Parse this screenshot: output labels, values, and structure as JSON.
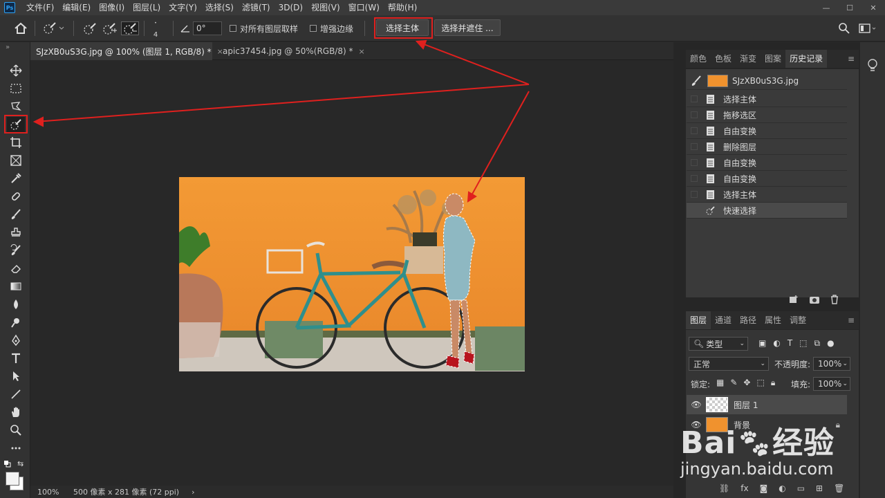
{
  "menubar": {
    "logo": "Ps",
    "items": [
      "文件(F)",
      "编辑(E)",
      "图像(I)",
      "图层(L)",
      "文字(Y)",
      "选择(S)",
      "滤镜(T)",
      "3D(D)",
      "视图(V)",
      "窗口(W)",
      "帮助(H)"
    ],
    "window_controls": [
      "—",
      "☐",
      "✕"
    ]
  },
  "options": {
    "brush_size": "4",
    "angle": "0°",
    "sample_all_layers": "对所有图层取样",
    "auto_enhance": "增强边缘",
    "select_subject": "选择主体",
    "select_and_mask": "选择并遮住 ..."
  },
  "tabs": [
    {
      "label": "SJzXB0uS3G.jpg @ 100% (图层 1, RGB/8) *",
      "close": "×"
    },
    {
      "label": "apic37454.jpg @ 50%(RGB/8) *",
      "close": "×"
    }
  ],
  "status": {
    "zoom": "100%",
    "doc_info": "500 像素 x 281 像素 (72 ppi)",
    "arrow": "›"
  },
  "top_panel_tabs": [
    "颜色",
    "色板",
    "渐变",
    "图案",
    "历史记录"
  ],
  "history": {
    "snapshot_name": "SJzXB0uS3G.jpg",
    "items": [
      "选择主体",
      "拖移选区",
      "自由变换",
      "删除图层",
      "自由变换",
      "自由变换",
      "选择主体",
      "快速选择"
    ]
  },
  "layers_tabs": [
    "图层",
    "通道",
    "路径",
    "属性",
    "调整"
  ],
  "layers": {
    "filter_kind": "类型",
    "blend_mode": "正常",
    "opacity_label": "不透明度:",
    "opacity": "100%",
    "lock_label": "锁定:",
    "fill_label": "填充:",
    "fill": "100%",
    "items": [
      {
        "name": "图层 1"
      },
      {
        "name": "背景"
      }
    ]
  },
  "watermark": {
    "brand": "Bai",
    "brand2": "经验",
    "url": "jingyan.baidu.com"
  },
  "colors": {
    "highlight": "#e0201e",
    "photo_bg": "#f0922e",
    "bike": "#2f8f8c"
  }
}
